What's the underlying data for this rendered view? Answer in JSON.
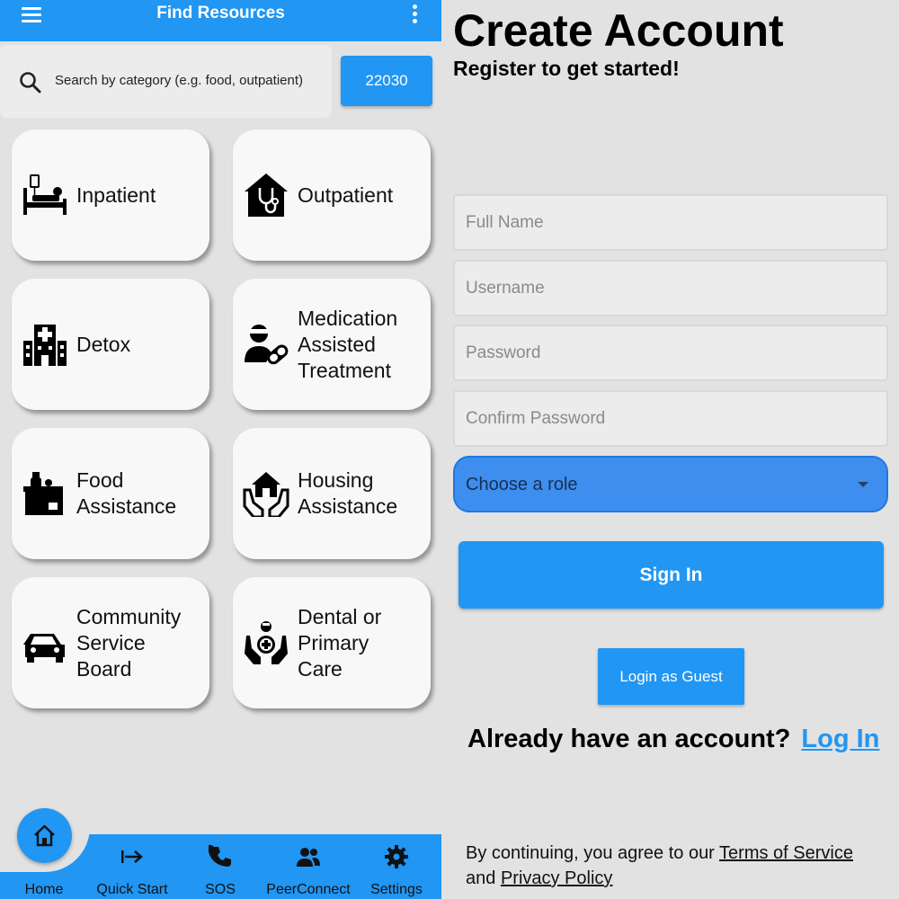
{
  "left_screen": {
    "app_bar": {
      "title": "Find Resources",
      "menu_icon": "menu-icon",
      "more_icon": "more-vert-icon"
    },
    "search": {
      "placeholder_text": "Search by category (e.g. food, outpatient)",
      "icon": "search-icon"
    },
    "zip_button": {
      "label": "22030"
    },
    "categories": [
      {
        "lines": [
          "Inpatient"
        ],
        "icon": "hospital-bed-icon"
      },
      {
        "lines": [
          "Outpatient"
        ],
        "icon": "house-stethoscope-icon"
      },
      {
        "lines": [
          "Detox"
        ],
        "icon": "hospital-building-icon"
      },
      {
        "lines": [
          "Medication",
          "Assisted",
          "Treatment"
        ],
        "icon": "doctor-pill-icon"
      },
      {
        "lines": [
          "Food",
          "Assistance"
        ],
        "icon": "food-box-icon"
      },
      {
        "lines": [
          "Housing",
          "Assistance"
        ],
        "icon": "hands-house-icon"
      },
      {
        "lines": [
          "Community",
          "Service",
          "Board"
        ],
        "icon": "car-icon"
      },
      {
        "lines": [
          "Dental or",
          "Primary",
          "Care"
        ],
        "icon": "medical-care-icon"
      }
    ],
    "bottom_nav": {
      "items": [
        {
          "label": "Home",
          "icon": "home-icon"
        },
        {
          "label": "Quick Start",
          "icon": "arrow-right-bar-icon"
        },
        {
          "label": "SOS",
          "icon": "phone-icon"
        },
        {
          "label": "PeerConnect",
          "icon": "people-icon"
        },
        {
          "label": "Settings",
          "icon": "gear-icon"
        }
      ]
    },
    "accent_color": "#2196f3"
  },
  "right_screen": {
    "title": "Create Account",
    "subtitle": "Register to get started!",
    "fields": [
      {
        "placeholder": "Full Name",
        "value": ""
      },
      {
        "placeholder": "Username",
        "value": ""
      },
      {
        "placeholder": "Password",
        "value": ""
      },
      {
        "placeholder": "Confirm Password",
        "value": ""
      }
    ],
    "role_select": {
      "value": "Choose a role"
    },
    "sign_in_label": "Sign In",
    "guest_label": "Login as Guest",
    "account_prompt": "Already have an account?",
    "login_link": "Log In",
    "terms": {
      "prefix": "By continuing, you agree to our ",
      "terms_link": "Terms of Service",
      "middle": "and ",
      "privacy_link": "Privacy Policy"
    }
  }
}
